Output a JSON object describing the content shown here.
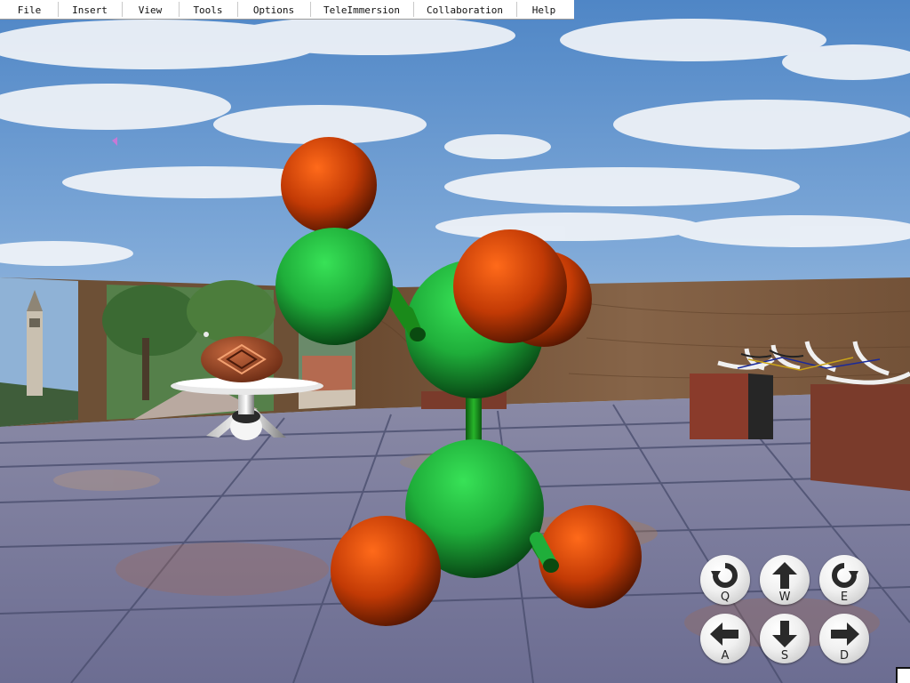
{
  "menubar": {
    "items": [
      {
        "label": "File"
      },
      {
        "label": "Insert"
      },
      {
        "label": "View"
      },
      {
        "label": "Tools"
      },
      {
        "label": "Options"
      },
      {
        "label": "TeleImmersion"
      },
      {
        "label": "Collaboration"
      },
      {
        "label": "Help"
      }
    ]
  },
  "viewport": {
    "description_icons": [
      "campanile-photo-panel",
      "campus-walkway-photo-panel",
      "woven-basket-on-pedestal",
      "molecule-model",
      "sculpture-on-pedestal"
    ]
  },
  "navigation": {
    "buttons": [
      {
        "key": "Q",
        "icon": "rotate-left-icon"
      },
      {
        "key": "W",
        "icon": "arrow-up-icon"
      },
      {
        "key": "E",
        "icon": "rotate-right-icon"
      },
      {
        "key": "A",
        "icon": "arrow-left-icon"
      },
      {
        "key": "S",
        "icon": "arrow-down-icon"
      },
      {
        "key": "D",
        "icon": "arrow-right-icon"
      }
    ]
  },
  "colors": {
    "atom_red": "#c23a05",
    "atom_green": "#1fae3a",
    "bond_green": "#1a8a1a",
    "sky_top": "#5b8fcb",
    "wall_wood": "#7a5a3e"
  }
}
